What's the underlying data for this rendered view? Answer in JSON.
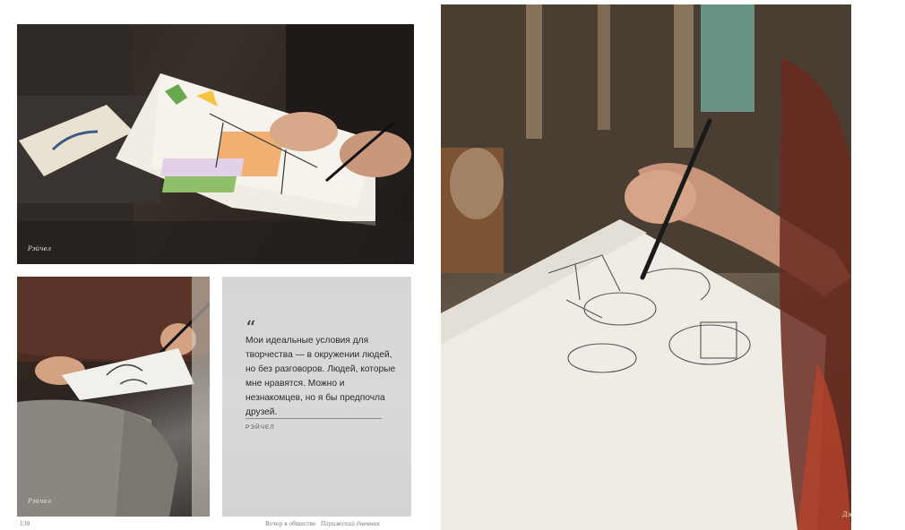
{
  "photos": {
    "top_left": {
      "caption": "Рэйчел"
    },
    "bottom_left": {
      "caption": "Рэйчел"
    },
    "right": {
      "caption": "Дж"
    }
  },
  "quote": {
    "mark": "“",
    "text": "Мои идеальные условия для творчества — в окружении людей, но без разговоров. Людей, которые мне нравятся. Можно и незнакомцев, но я бы предпочла друзей.",
    "author": "РЭЙЧЕЛ"
  },
  "footer": {
    "page_number": "138",
    "section": "Вечер в обществе",
    "subsection": "Парижский дневник"
  }
}
